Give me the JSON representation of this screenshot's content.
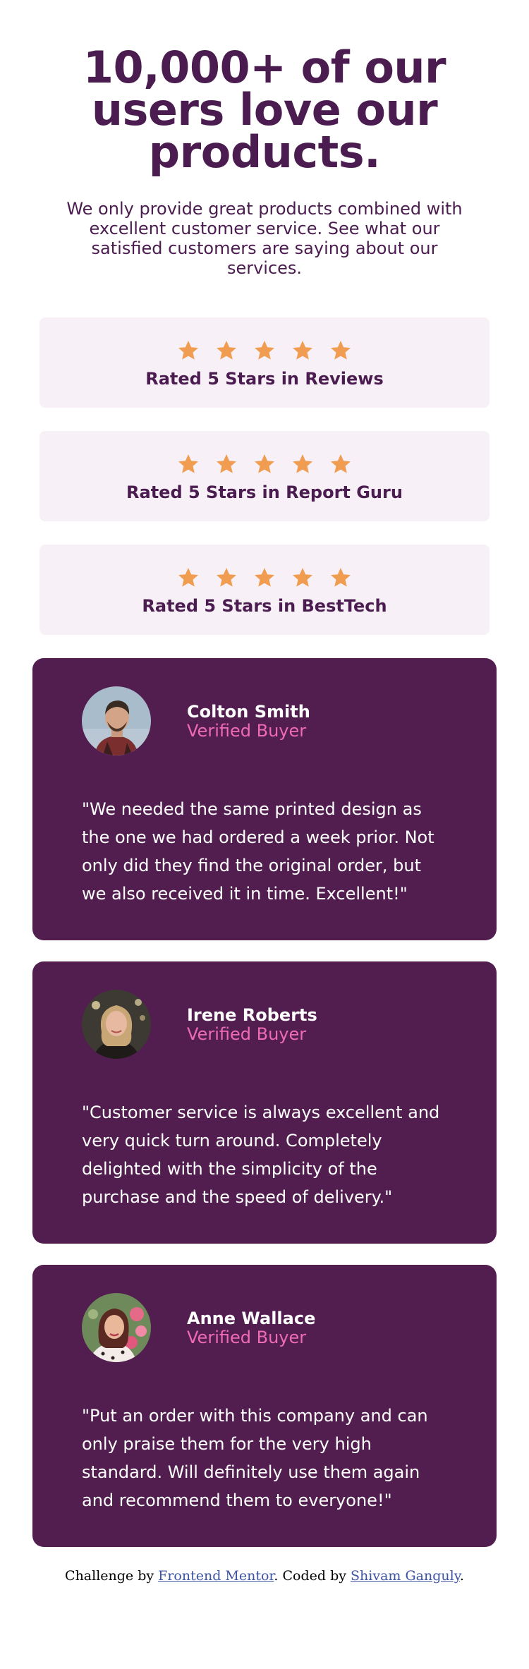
{
  "hero": {
    "title": "10,000+ of our users love our products.",
    "description": "We only provide great products combined with excellent customer service. See what our satisfied customers are saying about our services."
  },
  "star_color": "#f09d51",
  "ratings": [
    {
      "label": "Rated 5 Stars in Reviews",
      "stars": 5
    },
    {
      "label": "Rated 5 Stars in Report Guru",
      "stars": 5
    },
    {
      "label": "Rated 5 Stars in BestTech",
      "stars": 5
    }
  ],
  "testimonials": [
    {
      "name": "Colton Smith",
      "badge": "Verified Buyer",
      "quote": "\"We needed the same printed design as the one we had ordered a week prior. Not only did they find the original order, but we also received it in time. Excellent!\""
    },
    {
      "name": "Irene Roberts",
      "badge": "Verified Buyer",
      "quote": "\"Customer service is always excellent and very quick turn around. Completely delighted with the simplicity of the purchase and the speed of delivery.\""
    },
    {
      "name": "Anne Wallace",
      "badge": "Verified Buyer",
      "quote": "\"Put an order with this company and can only praise them for the very high standard. Will definitely use them again and recommend them to everyone!\""
    }
  ],
  "footer": {
    "prefix": "Challenge by ",
    "link1": "Frontend Mentor",
    "middle": ". Coded by ",
    "link2": "Shivam Ganguly",
    "suffix": "."
  }
}
